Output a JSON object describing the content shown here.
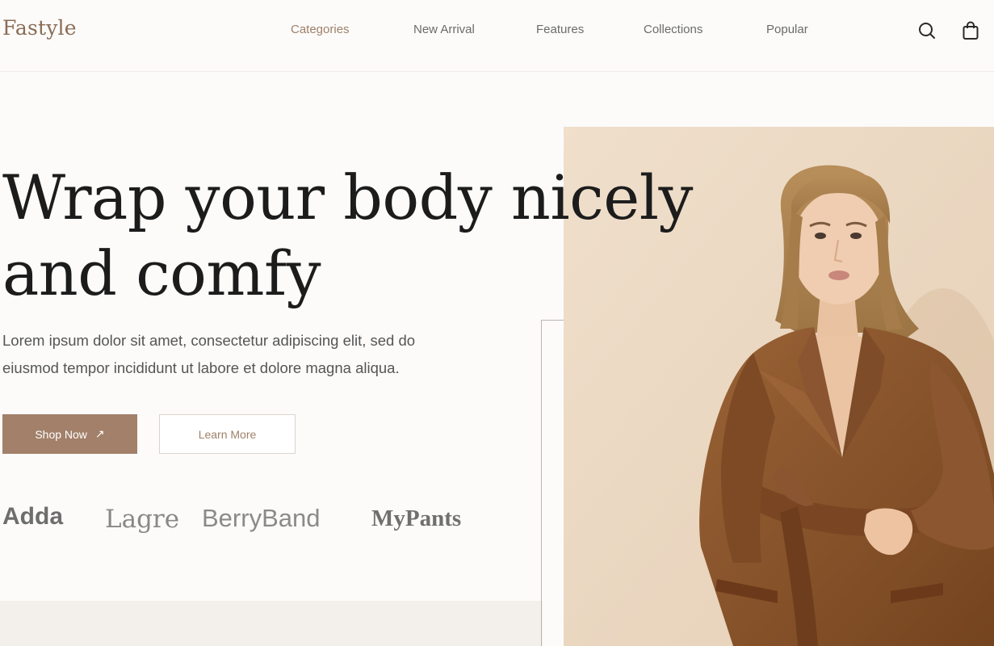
{
  "header": {
    "logo": "Fastyle",
    "nav": [
      {
        "label": "Categories",
        "active": true
      },
      {
        "label": "New Arrival",
        "active": false
      },
      {
        "label": "Features",
        "active": false
      },
      {
        "label": "Collections",
        "active": false
      },
      {
        "label": "Popular",
        "active": false
      }
    ],
    "icons": [
      "search-icon",
      "shopping-bag-icon"
    ]
  },
  "hero": {
    "title_line1": "Wrap your body nicely",
    "title_line2": "and comfy",
    "description_line1": "Lorem ipsum dolor sit amet, consectetur adipiscing elit, sed do",
    "description_line2": "eiusmod tempor incididunt ut labore et dolore magna aliqua.",
    "shop_button": "Shop Now",
    "shop_button_icon": "arrow-up-right-icon",
    "learn_button": "Learn More"
  },
  "brands": [
    "Adda",
    "Lagre",
    "BerryBand",
    "MyPants"
  ],
  "colors": {
    "accent": "#a2806a",
    "logo": "#8a6c55",
    "background": "#fcfbfa",
    "photo_backdrop": "#ecd9c3",
    "blazer": "#8a5530"
  }
}
